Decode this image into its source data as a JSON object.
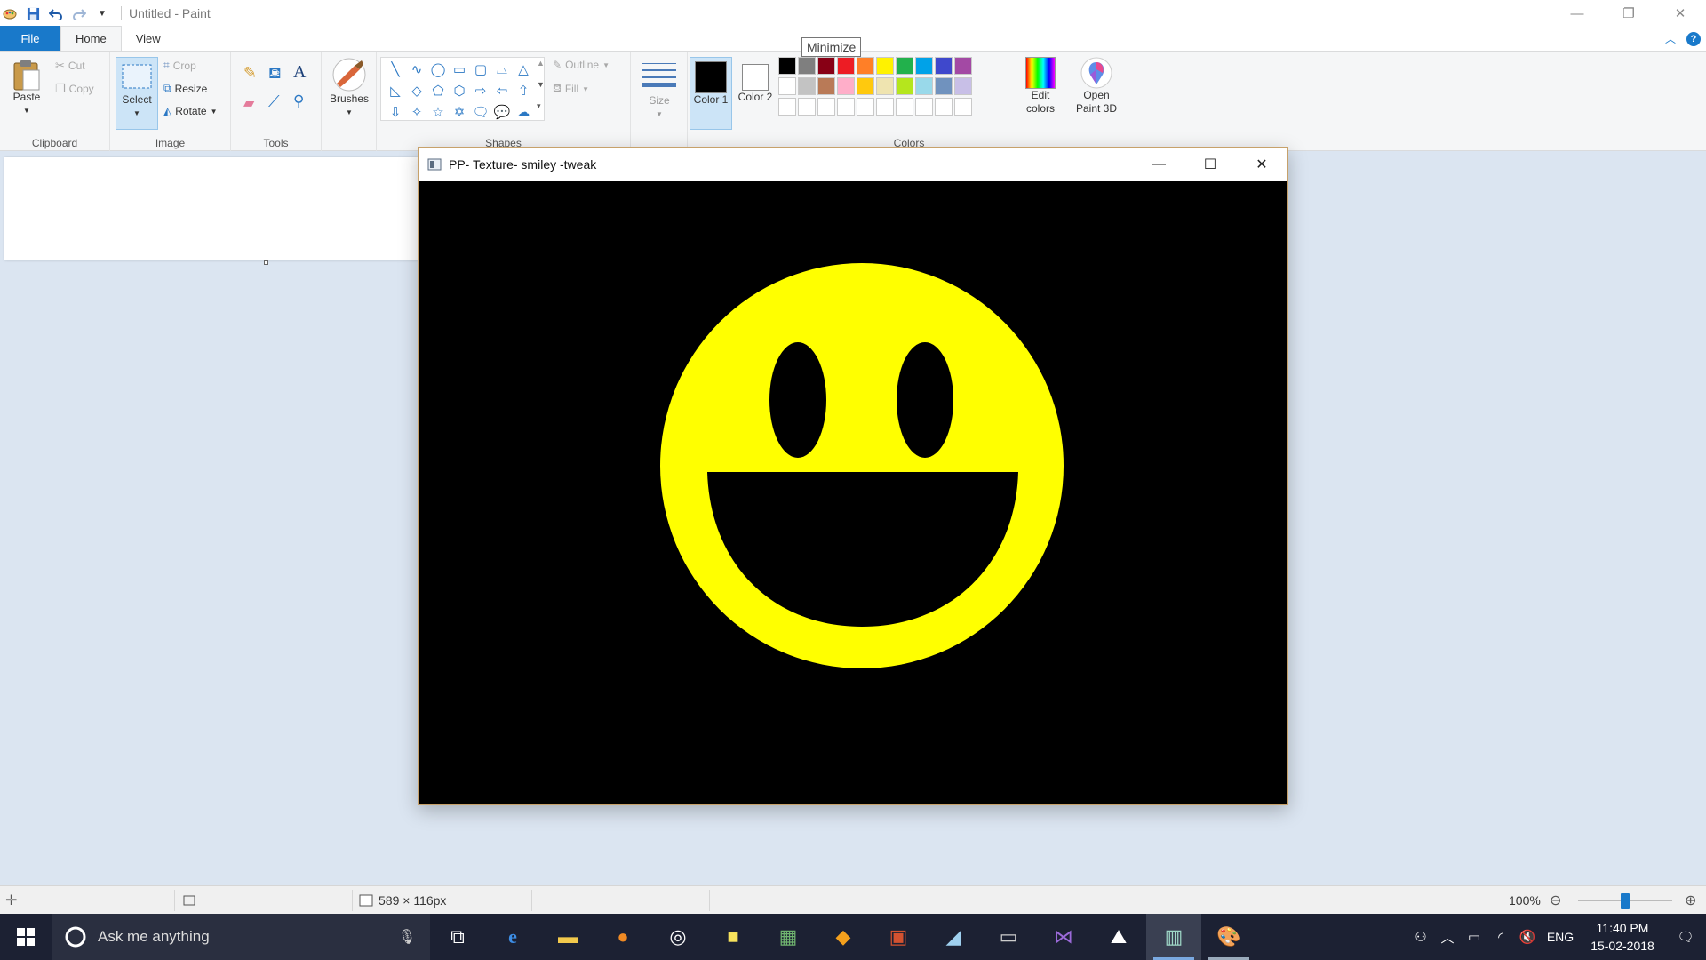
{
  "window": {
    "title": "Untitled - Paint",
    "controls": [
      "—",
      "❐",
      "✕"
    ]
  },
  "tabs": {
    "file": "File",
    "home": "Home",
    "view": "View"
  },
  "ribbon": {
    "clipboard": {
      "label": "Clipboard",
      "paste": "Paste",
      "cut": "Cut",
      "copy": "Copy"
    },
    "image": {
      "label": "Image",
      "select": "Select",
      "crop": "Crop",
      "resize": "Resize",
      "rotate": "Rotate"
    },
    "tools": {
      "label": "Tools"
    },
    "brushes": {
      "label": "Brushes"
    },
    "shapes": {
      "label": "Shapes",
      "outline": "Outline",
      "fill": "Fill"
    },
    "size": {
      "label": "Size"
    },
    "colors": {
      "label": "Colors",
      "color1": "Color 1",
      "color2": "Color 2",
      "edit_colors": "Edit colors",
      "open_paint3d": "Open Paint 3D",
      "color1_value": "#000000",
      "color2_value": "#ffffff",
      "palette": [
        "#000000",
        "#7f7f7f",
        "#880015",
        "#ed1c24",
        "#ff7f27",
        "#fff200",
        "#22b14c",
        "#00a2e8",
        "#3f48cc",
        "#a349a4",
        "#ffffff",
        "#c3c3c3",
        "#b97a57",
        "#ffaec9",
        "#ffc90e",
        "#efe4b0",
        "#b5e61d",
        "#99d9ea",
        "#7092be",
        "#c8bfe7",
        "#ffffff",
        "#ffffff",
        "#ffffff",
        "#ffffff",
        "#ffffff",
        "#ffffff",
        "#ffffff",
        "#ffffff",
        "#ffffff",
        "#ffffff"
      ]
    }
  },
  "tooltip": "Minimize",
  "float_window": {
    "title": "PP- Texture- smiley -tweak",
    "face_color": "#ffff00",
    "background": "#000000"
  },
  "statusbar": {
    "dimensions": "589 × 116px",
    "zoom": "100%"
  },
  "taskbar": {
    "search_placeholder": "Ask me anything",
    "language": "ENG",
    "time": "11:40 PM",
    "date": "15-02-2018"
  }
}
